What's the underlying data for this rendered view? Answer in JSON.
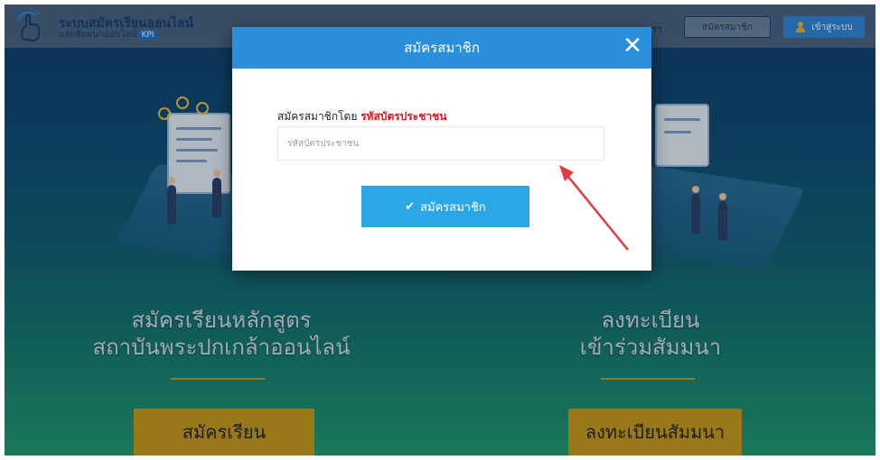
{
  "header": {
    "logo_icon": "hand-tap-icon",
    "site_title": "ระบบสมัครเรียนออนไลน์",
    "site_subtitle": "และสัมมนาออนไลน์",
    "kpi_badge": "KPI",
    "nav_partial": "รา",
    "register_button": "สมัครสมาชิก",
    "login_button": "เข้าสู่ระบบ",
    "login_icon": "user-icon"
  },
  "main": {
    "left_heading_line1": "สมัครเรียนหลักสูตร",
    "left_heading_line2": "สถาบันพระปกเกล้าออนไลน์",
    "left_button": "สมัครเรียน",
    "right_heading_line1": "ลงทะเบียน",
    "right_heading_line2": "เข้าร่วมสัมมนา",
    "right_button": "ลงทะเบียนสัมมนา"
  },
  "modal": {
    "title": "สมัครสมาชิก",
    "close_icon": "close-icon",
    "label_prefix": "สมัครสมาชิกโดย",
    "label_highlight": "รหัสบัตรประชาชน",
    "input_placeholder": "รหัสบัตรประชาชน",
    "input_value": "",
    "submit_label": "สมัครสมาชิก",
    "submit_icon": "check-icon"
  },
  "colors": {
    "modal_header": "#2b8fdc",
    "submit_button": "#2ba7e6",
    "highlight_red": "#e0141e",
    "gold_button": "#c79a15",
    "annotation_arrow": "#e23b3b"
  }
}
